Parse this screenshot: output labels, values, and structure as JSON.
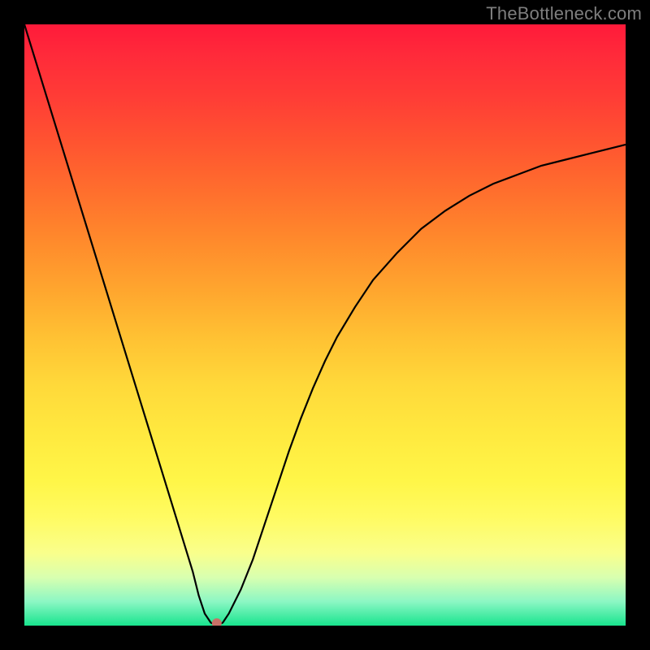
{
  "watermark": "TheBottleneck.com",
  "colors": {
    "frame_bg": "#000000",
    "curve": "#000000",
    "dot": "#c87168",
    "gradient_top": "#ff1a3a",
    "gradient_bottom": "#18e48e"
  },
  "chart_data": {
    "type": "line",
    "title": "",
    "xlabel": "",
    "ylabel": "",
    "xlim": [
      0,
      100
    ],
    "ylim": [
      0,
      100
    ],
    "x": [
      0,
      2,
      4,
      6,
      8,
      10,
      12,
      14,
      16,
      18,
      20,
      22,
      24,
      26,
      28,
      29,
      30,
      31,
      32,
      33,
      34,
      36,
      38,
      40,
      42,
      44,
      46,
      48,
      50,
      52,
      55,
      58,
      62,
      66,
      70,
      74,
      78,
      82,
      86,
      90,
      94,
      98,
      100
    ],
    "values": [
      100,
      93.5,
      87,
      80.5,
      74,
      67.5,
      61,
      54.5,
      48,
      41.5,
      35,
      28.5,
      22,
      15.5,
      9,
      5,
      2,
      0.5,
      0,
      0.5,
      2,
      6,
      11,
      17,
      23,
      29,
      34.5,
      39.5,
      44,
      48,
      53,
      57.5,
      62,
      66,
      69,
      71.5,
      73.5,
      75,
      76.5,
      77.5,
      78.5,
      79.5,
      80
    ],
    "series": [
      {
        "name": "curve",
        "values_ref": "values"
      }
    ],
    "marker": {
      "x": 32,
      "y": 0
    }
  }
}
